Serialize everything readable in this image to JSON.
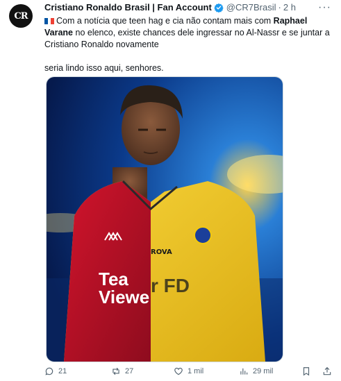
{
  "author": {
    "avatar_text": "CR",
    "name": "Cristiano Ronaldo Brasil | Fan Account",
    "handle": "@CR7Brasil",
    "separator": "·",
    "time": "2 h",
    "more_label": "···"
  },
  "tweet": {
    "text_before_bold": "Com a notícia que teen hag e cia não contam mais com ",
    "bold_name_1": "Raphael",
    "bold_name_2": "Varane",
    "text_after_bold": " no elenco, existe chances dele ingressar no Al-Nassr e se juntar a Cristiano Ronaldo novamente",
    "line_2": "seria lindo isso aqui, senhores."
  },
  "media": {
    "jersey_left_text_1": "Tea",
    "jersey_left_text_2": "Viewe",
    "jersey_right_text": "r FD",
    "sponsor_mark": "ROVA"
  },
  "actions": {
    "replies": "21",
    "reposts": "27",
    "likes": "1 mil",
    "views": "29 mil"
  },
  "colors": {
    "verified": "#1d9bf0",
    "secondary_text": "#536471",
    "man_utd_red": "#c8102e",
    "al_nassr_yellow": "#f2c80f"
  }
}
